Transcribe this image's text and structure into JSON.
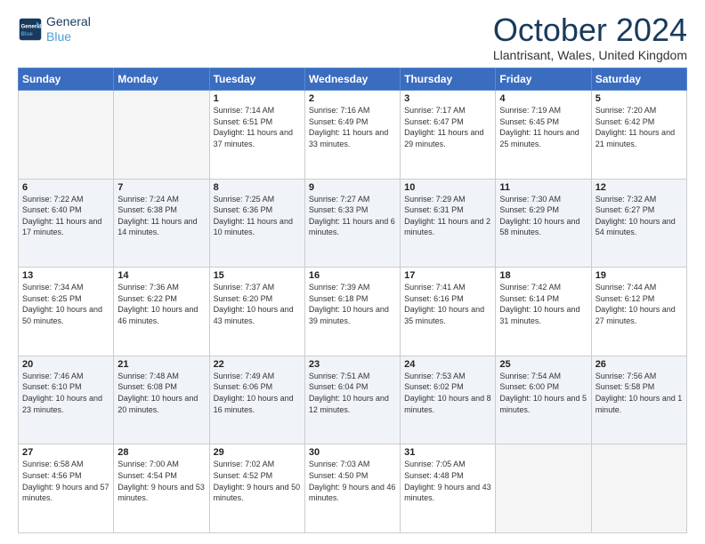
{
  "header": {
    "logo_line1": "General",
    "logo_line2": "Blue",
    "month_title": "October 2024",
    "location": "Llantrisant, Wales, United Kingdom"
  },
  "days_of_week": [
    "Sunday",
    "Monday",
    "Tuesday",
    "Wednesday",
    "Thursday",
    "Friday",
    "Saturday"
  ],
  "weeks": [
    [
      {
        "day": "",
        "text": ""
      },
      {
        "day": "",
        "text": ""
      },
      {
        "day": "1",
        "text": "Sunrise: 7:14 AM\nSunset: 6:51 PM\nDaylight: 11 hours and 37 minutes."
      },
      {
        "day": "2",
        "text": "Sunrise: 7:16 AM\nSunset: 6:49 PM\nDaylight: 11 hours and 33 minutes."
      },
      {
        "day": "3",
        "text": "Sunrise: 7:17 AM\nSunset: 6:47 PM\nDaylight: 11 hours and 29 minutes."
      },
      {
        "day": "4",
        "text": "Sunrise: 7:19 AM\nSunset: 6:45 PM\nDaylight: 11 hours and 25 minutes."
      },
      {
        "day": "5",
        "text": "Sunrise: 7:20 AM\nSunset: 6:42 PM\nDaylight: 11 hours and 21 minutes."
      }
    ],
    [
      {
        "day": "6",
        "text": "Sunrise: 7:22 AM\nSunset: 6:40 PM\nDaylight: 11 hours and 17 minutes."
      },
      {
        "day": "7",
        "text": "Sunrise: 7:24 AM\nSunset: 6:38 PM\nDaylight: 11 hours and 14 minutes."
      },
      {
        "day": "8",
        "text": "Sunrise: 7:25 AM\nSunset: 6:36 PM\nDaylight: 11 hours and 10 minutes."
      },
      {
        "day": "9",
        "text": "Sunrise: 7:27 AM\nSunset: 6:33 PM\nDaylight: 11 hours and 6 minutes."
      },
      {
        "day": "10",
        "text": "Sunrise: 7:29 AM\nSunset: 6:31 PM\nDaylight: 11 hours and 2 minutes."
      },
      {
        "day": "11",
        "text": "Sunrise: 7:30 AM\nSunset: 6:29 PM\nDaylight: 10 hours and 58 minutes."
      },
      {
        "day": "12",
        "text": "Sunrise: 7:32 AM\nSunset: 6:27 PM\nDaylight: 10 hours and 54 minutes."
      }
    ],
    [
      {
        "day": "13",
        "text": "Sunrise: 7:34 AM\nSunset: 6:25 PM\nDaylight: 10 hours and 50 minutes."
      },
      {
        "day": "14",
        "text": "Sunrise: 7:36 AM\nSunset: 6:22 PM\nDaylight: 10 hours and 46 minutes."
      },
      {
        "day": "15",
        "text": "Sunrise: 7:37 AM\nSunset: 6:20 PM\nDaylight: 10 hours and 43 minutes."
      },
      {
        "day": "16",
        "text": "Sunrise: 7:39 AM\nSunset: 6:18 PM\nDaylight: 10 hours and 39 minutes."
      },
      {
        "day": "17",
        "text": "Sunrise: 7:41 AM\nSunset: 6:16 PM\nDaylight: 10 hours and 35 minutes."
      },
      {
        "day": "18",
        "text": "Sunrise: 7:42 AM\nSunset: 6:14 PM\nDaylight: 10 hours and 31 minutes."
      },
      {
        "day": "19",
        "text": "Sunrise: 7:44 AM\nSunset: 6:12 PM\nDaylight: 10 hours and 27 minutes."
      }
    ],
    [
      {
        "day": "20",
        "text": "Sunrise: 7:46 AM\nSunset: 6:10 PM\nDaylight: 10 hours and 23 minutes."
      },
      {
        "day": "21",
        "text": "Sunrise: 7:48 AM\nSunset: 6:08 PM\nDaylight: 10 hours and 20 minutes."
      },
      {
        "day": "22",
        "text": "Sunrise: 7:49 AM\nSunset: 6:06 PM\nDaylight: 10 hours and 16 minutes."
      },
      {
        "day": "23",
        "text": "Sunrise: 7:51 AM\nSunset: 6:04 PM\nDaylight: 10 hours and 12 minutes."
      },
      {
        "day": "24",
        "text": "Sunrise: 7:53 AM\nSunset: 6:02 PM\nDaylight: 10 hours and 8 minutes."
      },
      {
        "day": "25",
        "text": "Sunrise: 7:54 AM\nSunset: 6:00 PM\nDaylight: 10 hours and 5 minutes."
      },
      {
        "day": "26",
        "text": "Sunrise: 7:56 AM\nSunset: 5:58 PM\nDaylight: 10 hours and 1 minute."
      }
    ],
    [
      {
        "day": "27",
        "text": "Sunrise: 6:58 AM\nSunset: 4:56 PM\nDaylight: 9 hours and 57 minutes."
      },
      {
        "day": "28",
        "text": "Sunrise: 7:00 AM\nSunset: 4:54 PM\nDaylight: 9 hours and 53 minutes."
      },
      {
        "day": "29",
        "text": "Sunrise: 7:02 AM\nSunset: 4:52 PM\nDaylight: 9 hours and 50 minutes."
      },
      {
        "day": "30",
        "text": "Sunrise: 7:03 AM\nSunset: 4:50 PM\nDaylight: 9 hours and 46 minutes."
      },
      {
        "day": "31",
        "text": "Sunrise: 7:05 AM\nSunset: 4:48 PM\nDaylight: 9 hours and 43 minutes."
      },
      {
        "day": "",
        "text": ""
      },
      {
        "day": "",
        "text": ""
      }
    ]
  ]
}
